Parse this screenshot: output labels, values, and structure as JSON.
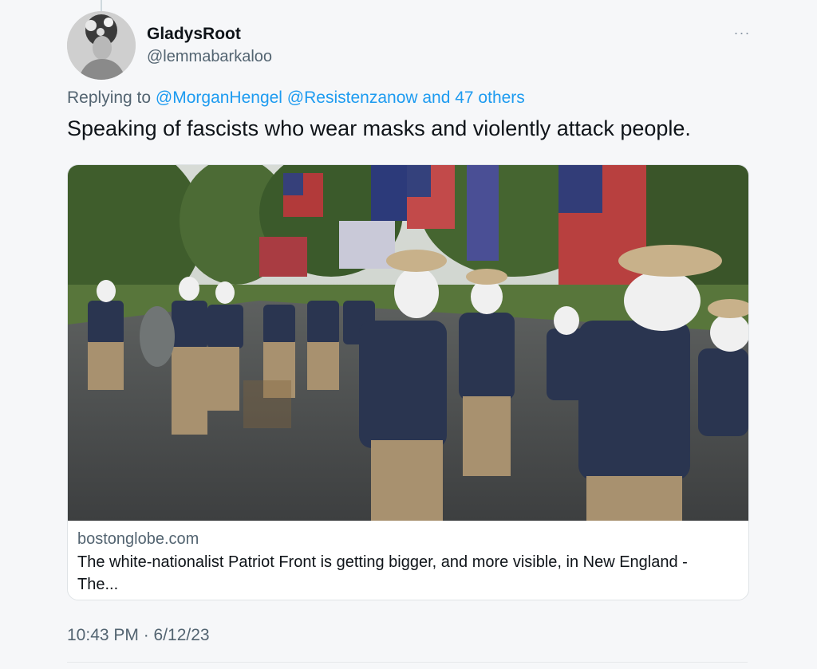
{
  "tweet": {
    "display_name": "GladysRoot",
    "handle": "@lemmabarkaloo",
    "more_icon": "ellipsis-icon",
    "more_label": "···",
    "replying_prefix": "Replying to",
    "replying_mentions": "@MorganHengel @Resistenzanow and 47 others",
    "text": "Speaking of fascists who wear masks and violently attack people.",
    "timestamp": "10:43 PM · 6/12/23"
  },
  "card": {
    "domain": "bostonglobe.com",
    "title": "The white-nationalist Patriot Front is getting bigger, and more visible, in New England - The..."
  },
  "colors": {
    "background": "#f6f7f9",
    "text_primary": "#0f1419",
    "text_secondary": "#536471",
    "link": "#1d9bf0",
    "border": "#dfe3e6"
  }
}
